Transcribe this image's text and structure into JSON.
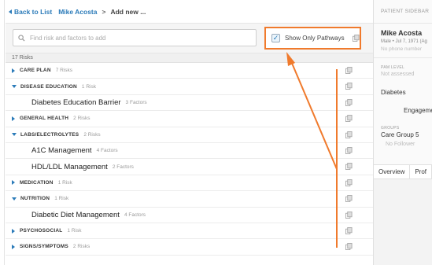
{
  "breadcrumb": {
    "back": "Back to List",
    "patient": "Mike Acosta",
    "sep": ">",
    "current": "Add new ..."
  },
  "search": {
    "placeholder": "Find risk and factors to add"
  },
  "pathways": {
    "label": "Show Only Pathways",
    "checked": true
  },
  "risk_count": "17 Risks",
  "rows": [
    {
      "kind": "group",
      "expanded": false,
      "name": "CARE PLAN",
      "count": "7 Risks"
    },
    {
      "kind": "group",
      "expanded": true,
      "name": "DISEASE EDUCATION",
      "count": "1 Risk"
    },
    {
      "kind": "item",
      "name": "Diabetes Education Barrier",
      "count": "3 Factors"
    },
    {
      "kind": "group",
      "expanded": false,
      "name": "GENERAL HEALTH",
      "count": "2 Risks"
    },
    {
      "kind": "group",
      "expanded": true,
      "name": "LABS/ELECTROLYTES",
      "count": "2 Risks"
    },
    {
      "kind": "item",
      "name": "A1C Management",
      "count": "4 Factors"
    },
    {
      "kind": "item",
      "name": "HDL/LDL Management",
      "count": "2 Factors"
    },
    {
      "kind": "group",
      "expanded": false,
      "name": "MEDICATION",
      "count": "1 Risk"
    },
    {
      "kind": "group",
      "expanded": true,
      "name": "NUTRITION",
      "count": "1 Risk"
    },
    {
      "kind": "item",
      "name": "Diabetic Diet Management",
      "count": "4 Factors"
    },
    {
      "kind": "group",
      "expanded": false,
      "name": "PSYCHOSOCIAL",
      "count": "1 Risk"
    },
    {
      "kind": "group",
      "expanded": false,
      "name": "SIGNS/SYMPTOMS",
      "count": "2 Risks"
    }
  ],
  "sidebar": {
    "title": "PATIENT SIDEBAR",
    "name": "Mike Acosta",
    "sub": "Male • Jul 7, 1971 (Ag",
    "phone": "No phone number",
    "pam_label": "PAM LEVEL",
    "pam_value": "Not assessed",
    "diagnosis": "Diabetes",
    "engagement": "Engageme",
    "groups_label": "GROUPS",
    "group": "Care Group 5",
    "follower": "No Follower",
    "tabs": [
      "Overview",
      "Prof"
    ]
  },
  "colors": {
    "accent": "#2b7bb9",
    "annotation": "#f07a2c"
  }
}
